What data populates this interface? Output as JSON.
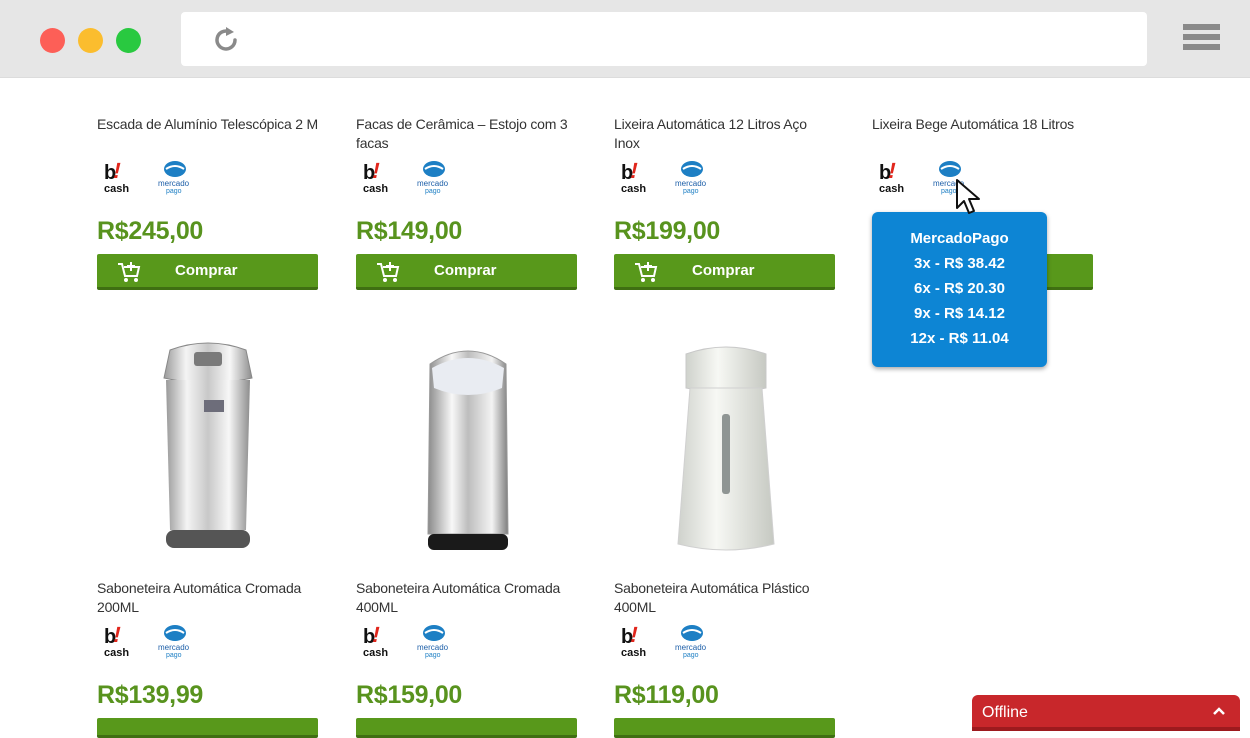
{
  "browser": {
    "reload_icon": "reload-icon",
    "menu_icon": "hamburger-menu-icon"
  },
  "products_top": [
    {
      "title": "Escada de Alumínio Telescópica 2 M",
      "price": "R$245,00",
      "buy_label": "Comprar"
    },
    {
      "title": "Facas de Cerâmica – Estojo com 3 facas",
      "price": "R$149,00",
      "buy_label": "Comprar"
    },
    {
      "title": "Lixeira Automática 12 Litros Aço Inox",
      "price": "R$199,00",
      "buy_label": "Comprar"
    },
    {
      "title": "Lixeira Bege Automática 18 Litros",
      "price": "",
      "buy_label": ""
    }
  ],
  "products_bottom": [
    {
      "title": "Saboneteira Automática Cromada 200ML",
      "price": "R$139,99"
    },
    {
      "title": "Saboneteira Automática Cromada 400ML",
      "price": "R$159,00"
    },
    {
      "title": "Saboneteira Automática Plástico 400ML",
      "price": "R$119,00"
    }
  ],
  "payment_logos": {
    "bcash_top": "b!",
    "bcash_bottom": "cash",
    "mercado_top": "mercado",
    "mercado_bottom": "pago"
  },
  "tooltip": {
    "title": "MercadoPago",
    "lines": [
      "3x - R$ 38.42",
      "6x - R$ 20.30",
      "9x - R$ 14.12",
      "12x - R$ 11.04"
    ]
  },
  "chat": {
    "label": "Offline"
  },
  "colors": {
    "price": "#58931e",
    "button": "#58981b",
    "tooltip": "#0d85d4",
    "offline": "#c8272b"
  }
}
